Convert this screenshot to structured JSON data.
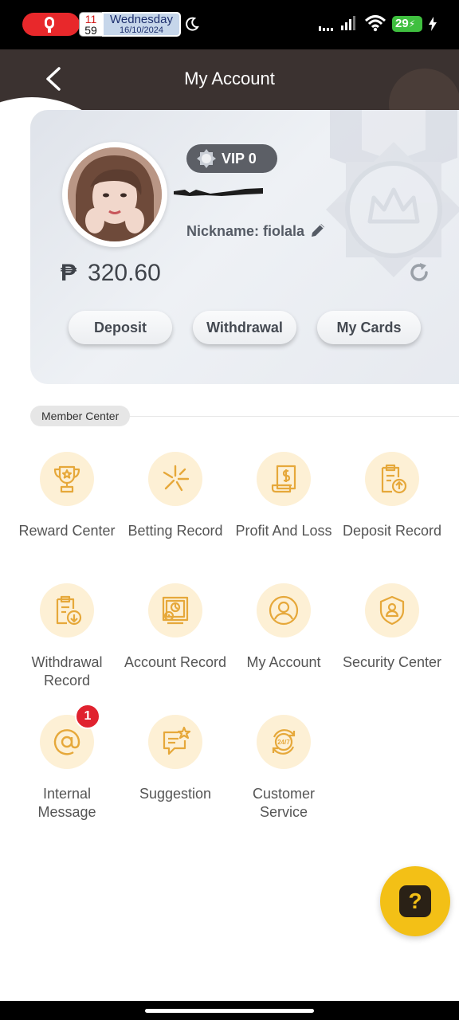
{
  "status_bar": {
    "clock_hour": "11",
    "clock_minute": "59",
    "day": "Wednesday",
    "date": "16/10/2024",
    "battery": "29",
    "icons": [
      "mic-icon",
      "moon-icon",
      "signal-dots-icon",
      "signal-bars-icon",
      "wifi-icon",
      "battery-icon",
      "charging-bolt-icon"
    ]
  },
  "header": {
    "title": "My Account",
    "back_icon": "chevron-left-icon"
  },
  "account": {
    "vip_label": "VIP 0",
    "nickname": "Nickname: fiolala",
    "currency_symbol": "₱",
    "balance": "320.60",
    "buttons": [
      "Deposit",
      "Withdrawal",
      "My Cards"
    ],
    "icons": [
      "avatar",
      "vip-medal-icon",
      "edit-pencil-icon",
      "refresh-icon"
    ]
  },
  "member_center": {
    "title": "Member Center",
    "items": [
      {
        "label": "Reward Center",
        "icon": "trophy-icon"
      },
      {
        "label": "Betting Record",
        "icon": "sparkle-icon"
      },
      {
        "label": "Profit And Loss",
        "icon": "receipt-dollar-icon"
      },
      {
        "label": "Deposit Record",
        "icon": "clipboard-upload-icon"
      },
      {
        "label": "Withdrawal Record",
        "icon": "clipboard-download-icon"
      },
      {
        "label": "Account Record",
        "icon": "monitor-chart-icon"
      },
      {
        "label": "My Account",
        "icon": "user-circle-icon"
      },
      {
        "label": "Security Center",
        "icon": "shield-user-icon"
      },
      {
        "label": "Internal Message",
        "icon": "at-sign-icon",
        "badge": "1"
      },
      {
        "label": "Suggestion",
        "icon": "chat-star-icon"
      },
      {
        "label": "Customer Service",
        "icon": "support-24-7-icon"
      }
    ]
  },
  "help_button": {
    "label": "?",
    "icon": "question-mark-icon"
  },
  "colors": {
    "header_bg": "#3b3230",
    "accent_yellow": "#f3c016",
    "icon_bg": "#fdf0d5",
    "icon_stroke": "#e6a83a",
    "badge_red": "#e0222f",
    "recording_red": "#e8282b",
    "battery_green": "#3fbf3f"
  }
}
